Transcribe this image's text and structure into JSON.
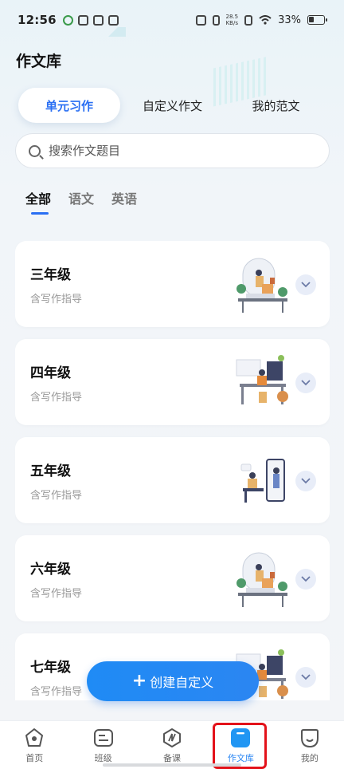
{
  "status_bar": {
    "time": "12:56",
    "net_speed_value": "28.5",
    "net_speed_unit": "KB/s",
    "battery_percent": "33%"
  },
  "page": {
    "title": "作文库"
  },
  "segment_tabs": [
    {
      "label": "单元习作",
      "active": true
    },
    {
      "label": "自定义作文",
      "active": false
    },
    {
      "label": "我的范文",
      "active": false
    }
  ],
  "search": {
    "placeholder": "搜索作文题目"
  },
  "subject_tabs": [
    {
      "label": "全部",
      "active": true
    },
    {
      "label": "语文",
      "active": false
    },
    {
      "label": "英语",
      "active": false
    }
  ],
  "grades": [
    {
      "title": "三年级",
      "subtitle": "含写作指导",
      "illustration": "balcony-illustration"
    },
    {
      "title": "四年级",
      "subtitle": "含写作指导",
      "illustration": "desk-illustration"
    },
    {
      "title": "五年级",
      "subtitle": "含写作指导",
      "illustration": "mirror-illustration"
    },
    {
      "title": "六年级",
      "subtitle": "含写作指导",
      "illustration": "balcony-illustration"
    },
    {
      "title": "七年级",
      "subtitle": "含写作指导",
      "illustration": "desk-illustration"
    }
  ],
  "fab": {
    "icon": "plus-icon",
    "label": "创建自定义"
  },
  "bottom_nav": [
    {
      "label": "首页",
      "icon": "home-icon",
      "active": false
    },
    {
      "label": "班级",
      "icon": "class-icon",
      "active": false
    },
    {
      "label": "备课",
      "icon": "lesson-prep-icon",
      "active": false
    },
    {
      "label": "作文库",
      "icon": "essay-library-icon",
      "active": true
    },
    {
      "label": "我的",
      "icon": "profile-icon",
      "active": false
    }
  ],
  "colors": {
    "accent": "#2a6ff3",
    "fab": "#1f8bf5",
    "highlight_box": "#e3121a"
  }
}
